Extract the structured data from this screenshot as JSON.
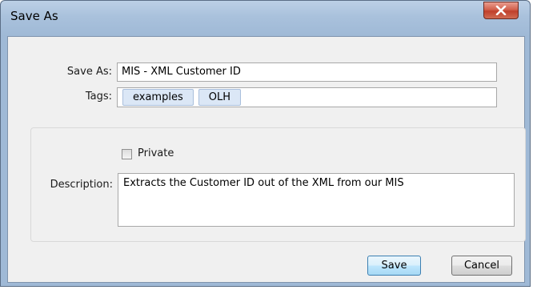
{
  "window": {
    "title": "Save As",
    "close_icon": "close-x-icon"
  },
  "form": {
    "save_as_label": "Save As:",
    "save_as_value": "MIS - XML Customer ID",
    "tags_label": "Tags:",
    "tags": [
      "examples",
      "OLH"
    ],
    "private_label": "Private",
    "private_checked": false,
    "description_label": "Description:",
    "description_value": "Extracts the Customer ID out of the XML from our MIS"
  },
  "buttons": {
    "save_label": "Save",
    "cancel_label": "Cancel"
  },
  "colors": {
    "titlebar": "#a9c1dc",
    "close_button": "#c7503c",
    "dialog_bg": "#f0f0f0",
    "tag_bg": "#dbe7f6",
    "default_button_border": "#3c7fb1"
  }
}
